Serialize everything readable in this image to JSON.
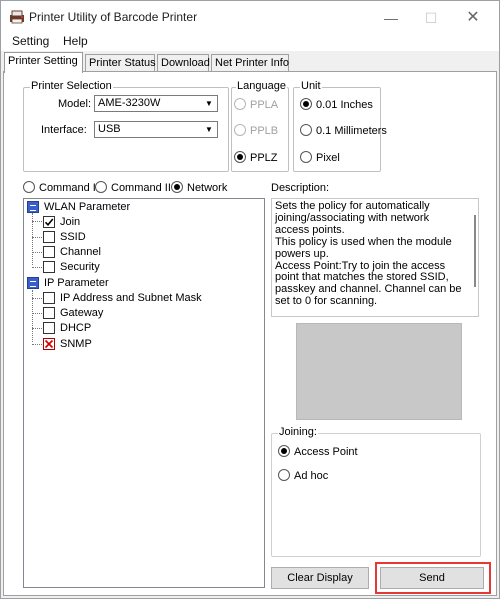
{
  "window": {
    "title": "Printer Utility of Barcode Printer",
    "icon": "printer-app-icon",
    "controls": {
      "minimize": "—",
      "maximize": "☐",
      "close": "✕"
    }
  },
  "menu": {
    "items": [
      "Setting",
      "Help"
    ]
  },
  "tabs": [
    "Printer Setting",
    "Printer Status",
    "Download",
    "Net Printer Info"
  ],
  "active_tab": "Printer Setting",
  "printer_selection": {
    "label": "Printer Selection",
    "model_label": "Model:",
    "model_value": "AME-3230W",
    "interface_label": "Interface:",
    "interface_value": "USB"
  },
  "language": {
    "label": "Language",
    "options": [
      "PPLA",
      "PPLB",
      "PPLZ"
    ],
    "selected": "PPLZ"
  },
  "unit": {
    "label": "Unit",
    "options": [
      "0.01 Inches",
      "0.1 Millimeters",
      "Pixel"
    ],
    "selected": "0.01 Inches"
  },
  "command_mode": {
    "options": [
      "Command I",
      "Command II",
      "Network"
    ],
    "selected": "Network"
  },
  "tree": {
    "groups": [
      {
        "label": "WLAN Parameter",
        "items": [
          {
            "label": "Join",
            "state": "checked"
          },
          {
            "label": "SSID",
            "state": "unchecked"
          },
          {
            "label": "Channel",
            "state": "unchecked"
          },
          {
            "label": "Security",
            "state": "unchecked"
          }
        ]
      },
      {
        "label": "IP Parameter",
        "items": [
          {
            "label": "IP Address and Subnet Mask",
            "state": "unchecked"
          },
          {
            "label": "Gateway",
            "state": "unchecked"
          },
          {
            "label": "DHCP",
            "state": "unchecked"
          },
          {
            "label": "SNMP",
            "state": "cross"
          }
        ]
      }
    ]
  },
  "description": {
    "label": "Description:",
    "text": "Sets the policy for automatically joining/associating with network access points.\nThis policy is used when the module powers up.\nAccess Point:Try to join the access point that matches the stored SSID, passkey and channel. Channel can be set to 0 for scanning."
  },
  "joining": {
    "label": "Joining:",
    "options": [
      "Access Point",
      "Ad hoc"
    ],
    "selected": "Access Point"
  },
  "buttons": {
    "clear_display": "Clear Display",
    "send": "Send"
  },
  "colors": {
    "highlight": "#e53935",
    "preview_bg": "#c8c8c8",
    "tree_group_icon": "#3a5fcd"
  }
}
